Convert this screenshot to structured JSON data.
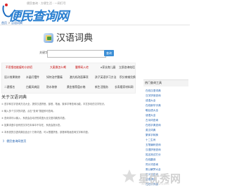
{
  "header": {
    "logo_text": "便民查询网",
    "slogan": "便民查询 · 方便生活 · 一网打尽"
  },
  "breadcrumb": {
    "home": "首页",
    "sep": " > ",
    "current": "汉语词典"
  },
  "main": {
    "title": "汉语词典",
    "search_label": "关键字：",
    "search_value": "",
    "search_placeholder": "",
    "search_button": "查询"
  },
  "links": [
    [
      "不用饿也能瘦的小妙招",
      "大麦换怎么喝",
      "腰臀码入宅",
      "e家长育儿展",
      "立即咨询电话"
    ],
    [
      "设计效果装修",
      "水晶灯摆件",
      "如何治疗腰痛",
      "激光机改面事项",
      "孩子英语学习方法",
      "积分商城兑换"
    ],
    [
      "二建报名",
      "白癜风病因",
      "防水装修",
      "黄金推荐盘价格",
      "新生活服务",
      "长寿看家材料网"
    ]
  ],
  "about": {
    "title": "关于汉语词典",
    "paragraphs": [
      "① 查字和汉字查询方法大全，提供汉语拼音，部首，笔画，繁体字等查询功能，丰富多彩的汉字知识。",
      "② 输入多个汉字的词语，点击“查询”按钮即可查询。",
      "③ 查询词可以输入，系统会自动识别成语大全汉语词典的词语。",
      "④ 如果词语中含有的汉字在本库中不存在，系统会提示您。",
      "⑤ 本系统的汉语词典包含近十万条词语，可以根据拼音，部首和笔画查询汉字和词语。"
    ],
    "more": "》 便民查询网首页"
  },
  "sidebar": {
    "title": "热门查询工具",
    "items": [
      "在线汉语词典",
      "汉字拼音查询",
      "成语大全",
      "在线新华字典",
      "歇后语大全",
      "谜语大全",
      "古诗词查询",
      "在线字典查询",
      "英汉词典",
      "繁体字转换",
      "十二生肖",
      "五笔编码查询",
      "汉语拼音查询",
      "姓名测试打分",
      "在线翻译",
      "同义词查询",
      "周公解梦大全",
      "反义词查询",
      "谜语猜谜",
      "在线计算器"
    ]
  },
  "watermark": {
    "title": "星优秀网",
    "subtitle": "xingyouxiu.com"
  }
}
